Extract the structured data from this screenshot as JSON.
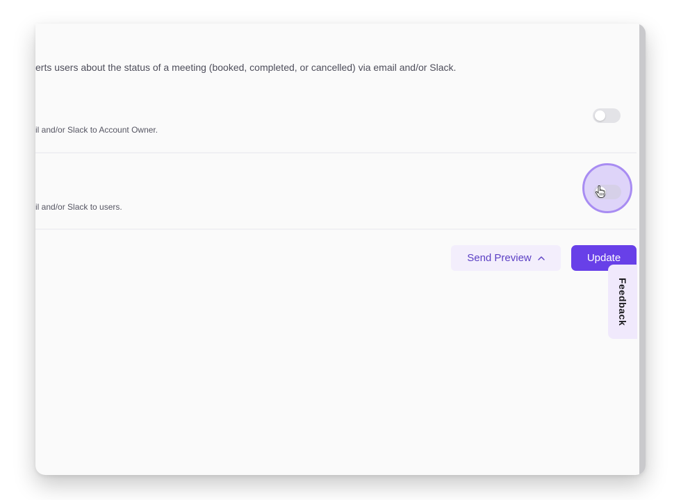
{
  "description": "erts users about the status of a meeting (booked, completed, or cancelled) via email and/or Slack.",
  "cards": [
    {
      "subtitle": "il and/or Slack to Account Owner.",
      "toggle_on": false
    },
    {
      "subtitle": "il and/or Slack to users.",
      "toggle_on": false
    }
  ],
  "actions": {
    "send_preview_label": "Send Preview",
    "update_label": "Update"
  },
  "feedback_label": "Feedback",
  "icons": {
    "chevron": "chevron-up-icon",
    "cursor": "hand-pointer-icon"
  },
  "colors": {
    "accent": "#6840e8",
    "accent_light": "#f3eefc",
    "highlight": "#a88cf2"
  }
}
